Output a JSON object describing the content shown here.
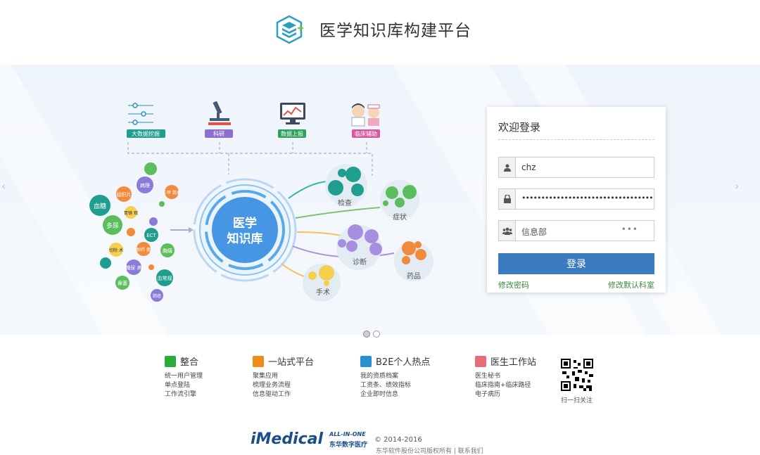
{
  "header": {
    "title": "医学知识库构建平台",
    "logo_icon": "stacked-books-icon"
  },
  "diagram": {
    "top_labels": [
      "大数据挖掘",
      "科研",
      "数据上报",
      "临床辅助"
    ],
    "top_label_colors": [
      "#1f9e8f",
      "#8c6fd1",
      "#2ea15a",
      "#d857a0"
    ],
    "center_line1": "医学",
    "center_line2": "知识库",
    "branches": [
      "检查",
      "症状",
      "诊断",
      "药品",
      "手术"
    ],
    "bubbles": [
      "血糖",
      "多尿",
      "病理",
      "组织片",
      "三甲 数据",
      "ECT",
      "胃镜 观",
      "NMR",
      "切除 术",
      "耐药 菌",
      "胸痛",
      "糖尿 病",
      "血常规",
      "鼻塞",
      "肺癌"
    ]
  },
  "login": {
    "title": "欢迎登录",
    "username": "chz",
    "password_mask": "••••••••••••••••••••••••••••••••••",
    "department": "信息部",
    "department_more": "•••",
    "submit_label": "登录",
    "change_password_link": "修改密码",
    "change_default_dept_link": "修改默认科室"
  },
  "footer": {
    "columns": [
      {
        "title": "整合",
        "color": "#2eaa3c",
        "items": [
          "统一用户管理",
          "单点登陆",
          "工作流引擎"
        ]
      },
      {
        "title": "一站式平台",
        "color": "#f08c1a",
        "items": [
          "聚集应用",
          "梳理业务流程",
          "信息驱动工作"
        ]
      },
      {
        "title": "B2E个人热点",
        "color": "#2a8fd0",
        "items": [
          "我的资质档案",
          "工资条、绩效指标",
          "企业即时信息"
        ]
      },
      {
        "title": "医生工作站",
        "color": "#e86b7a",
        "items": [
          "医生秘书",
          "临床指南+临床路径",
          "电子病历"
        ]
      }
    ],
    "qr_label": "扫一扫关注",
    "brand": "iMedical",
    "brand_sub1": "ALL-IN-ONE",
    "brand_sub2": "东华数字医疗",
    "copyright": "© 2014-2016",
    "company": "东华软件股份公司版权所有 | 联系我们"
  }
}
